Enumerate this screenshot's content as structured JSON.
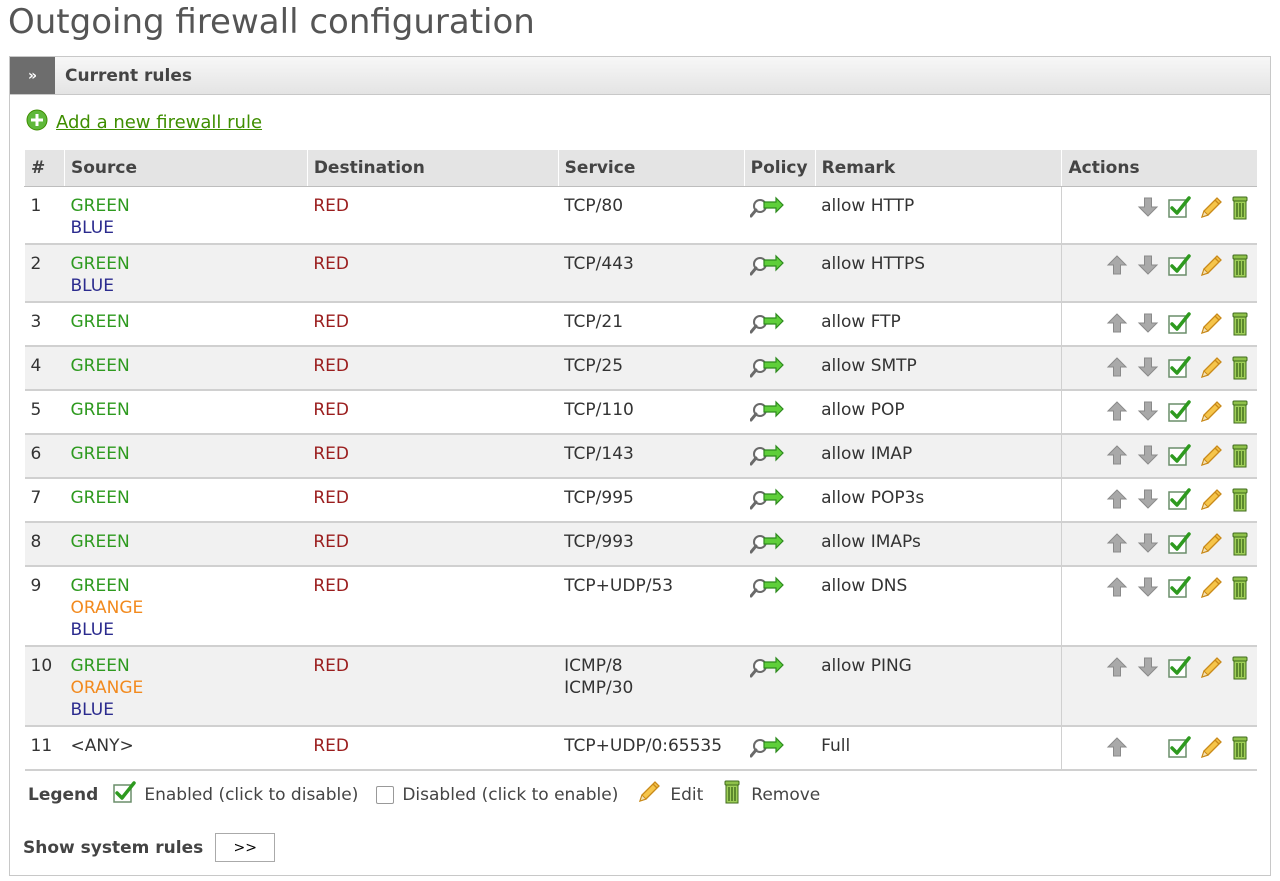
{
  "page_title": "Outgoing firewall configuration",
  "panel": {
    "collapse_label": "»",
    "title": "Current rules"
  },
  "add_rule_label": "Add a new firewall rule",
  "columns": [
    "#",
    "Source",
    "Destination",
    "Service",
    "Policy",
    "Remark",
    "Actions"
  ],
  "zone_colors": {
    "GREEN": "#2e9a1f",
    "BLUE": "#2b2b8e",
    "ORANGE": "#f28a1e",
    "RED": "#9a1d1d"
  },
  "rules": [
    {
      "num": "1",
      "source": [
        "GREEN",
        "BLUE"
      ],
      "destination": "RED",
      "service": [
        "TCP/80"
      ],
      "policy_icon": "allow-arrow-icon",
      "remark": "allow HTTP",
      "up": false,
      "down": true
    },
    {
      "num": "2",
      "source": [
        "GREEN",
        "BLUE"
      ],
      "destination": "RED",
      "service": [
        "TCP/443"
      ],
      "policy_icon": "allow-arrow-icon",
      "remark": "allow HTTPS",
      "up": true,
      "down": true
    },
    {
      "num": "3",
      "source": [
        "GREEN"
      ],
      "destination": "RED",
      "service": [
        "TCP/21"
      ],
      "policy_icon": "allow-arrow-icon",
      "remark": "allow FTP",
      "up": true,
      "down": true
    },
    {
      "num": "4",
      "source": [
        "GREEN"
      ],
      "destination": "RED",
      "service": [
        "TCP/25"
      ],
      "policy_icon": "allow-arrow-icon",
      "remark": "allow SMTP",
      "up": true,
      "down": true
    },
    {
      "num": "5",
      "source": [
        "GREEN"
      ],
      "destination": "RED",
      "service": [
        "TCP/110"
      ],
      "policy_icon": "allow-arrow-icon",
      "remark": "allow POP",
      "up": true,
      "down": true
    },
    {
      "num": "6",
      "source": [
        "GREEN"
      ],
      "destination": "RED",
      "service": [
        "TCP/143"
      ],
      "policy_icon": "allow-arrow-icon",
      "remark": "allow IMAP",
      "up": true,
      "down": true
    },
    {
      "num": "7",
      "source": [
        "GREEN"
      ],
      "destination": "RED",
      "service": [
        "TCP/995"
      ],
      "policy_icon": "allow-arrow-icon",
      "remark": "allow POP3s",
      "up": true,
      "down": true
    },
    {
      "num": "8",
      "source": [
        "GREEN"
      ],
      "destination": "RED",
      "service": [
        "TCP/993"
      ],
      "policy_icon": "allow-arrow-icon",
      "remark": "allow IMAPs",
      "up": true,
      "down": true
    },
    {
      "num": "9",
      "source": [
        "GREEN",
        "ORANGE",
        "BLUE"
      ],
      "destination": "RED",
      "service": [
        "TCP+UDP/53"
      ],
      "policy_icon": "allow-arrow-icon",
      "remark": "allow DNS",
      "up": true,
      "down": true
    },
    {
      "num": "10",
      "source": [
        "GREEN",
        "ORANGE",
        "BLUE"
      ],
      "destination": "RED",
      "service": [
        "ICMP/8",
        "ICMP/30"
      ],
      "policy_icon": "allow-arrow-icon",
      "remark": "allow PING",
      "up": true,
      "down": true
    },
    {
      "num": "11",
      "source": [
        "<ANY>"
      ],
      "destination": "RED",
      "service": [
        "TCP+UDP/0:65535"
      ],
      "policy_icon": "allow-arrow-icon",
      "remark": "Full",
      "up": true,
      "down": false
    }
  ],
  "legend": {
    "label": "Legend",
    "enabled": "Enabled (click to disable)",
    "disabled": "Disabled (click to enable)",
    "edit": "Edit",
    "remove": "Remove"
  },
  "system_rules": {
    "label": "Show system rules",
    "button": ">>"
  }
}
